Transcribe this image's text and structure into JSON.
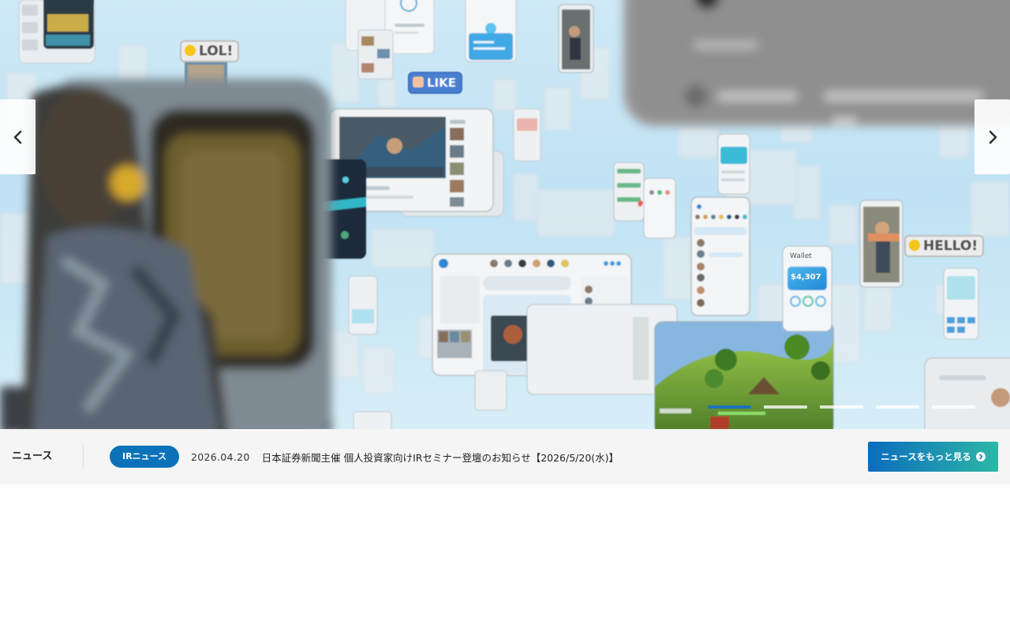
{
  "hero": {
    "bubbles": {
      "lol": "LOL!",
      "like": "LIKE",
      "hello": "HELLO!",
      "wallet": "Wallet",
      "wallet_amount": "$4,307"
    },
    "prev_icon": "chevron-left-icon",
    "next_icon": "chevron-right-icon",
    "slides_total": 5,
    "active_slide": 1,
    "active_slide_progress": 1.0
  },
  "news": {
    "section_label": "ニュース",
    "tag": "IRニュース",
    "date": "2026.04.20",
    "title": "日本証券新聞主催 個人投資家向けIRセミナー登壇のお知らせ【2026/5/20(水)】",
    "more_label": "ニュースをもっと見る",
    "more_icon": "arrow-circle-right-icon"
  },
  "colors": {
    "accent_blue": "#0b72b9",
    "gradient_start": "#0b6cbf",
    "gradient_end": "#2db7a6",
    "newsbar_bg": "#f5f5f5"
  }
}
